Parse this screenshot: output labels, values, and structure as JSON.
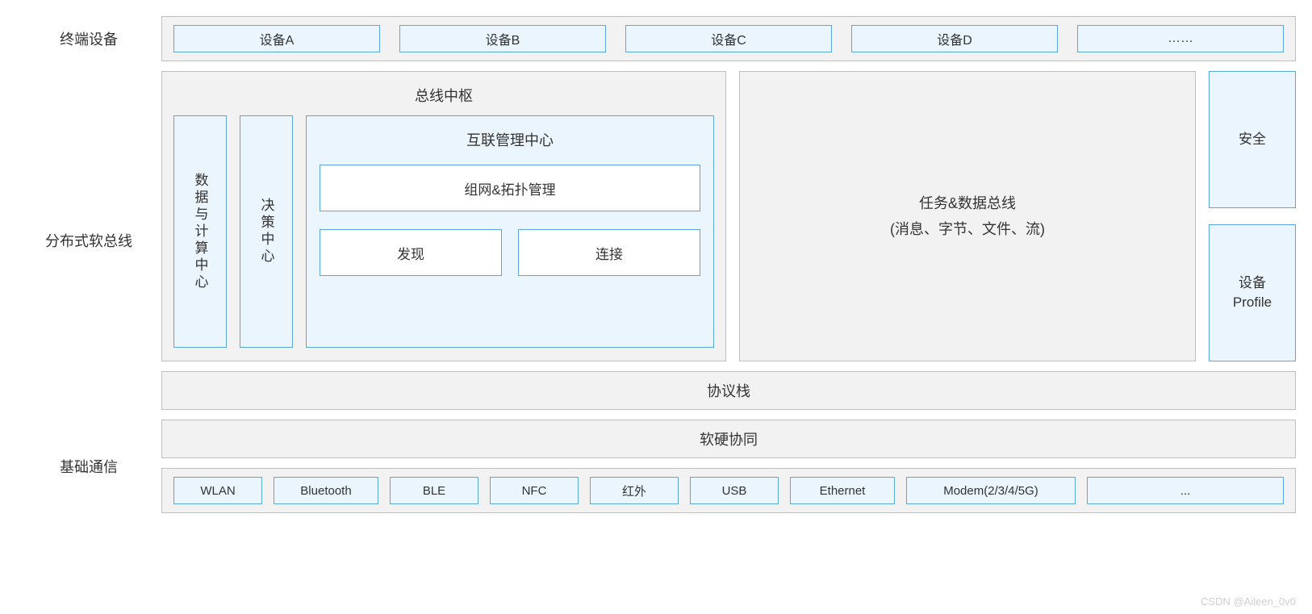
{
  "labels": {
    "devices": "终端设备",
    "bus": "分布式软总线",
    "comm": "基础通信"
  },
  "devices": {
    "items": [
      "设备A",
      "设备B",
      "设备C",
      "设备D",
      "……"
    ]
  },
  "bus": {
    "hub_title": "总线中枢",
    "data_center": "数据与计算中心",
    "decision_center": "决策中心",
    "interconn": {
      "title": "互联管理中心",
      "topo": "组网&拓扑管理",
      "discover": "发现",
      "connect": "连接"
    },
    "task_bus": {
      "line1": "任务&数据总线",
      "line2": "(消息、字节、文件、流)"
    },
    "right": {
      "security": "安全",
      "profile": "设备\nProfile"
    },
    "protocol_stack": "协议栈"
  },
  "comm": {
    "coop": "软硬协同",
    "protocols": [
      "WLAN",
      "Bluetooth",
      "BLE",
      "NFC",
      "红外",
      "USB",
      "Ethernet",
      "Modem(2/3/4/5G)",
      "..."
    ]
  },
  "watermark": "CSDN @Aileen_0v0"
}
